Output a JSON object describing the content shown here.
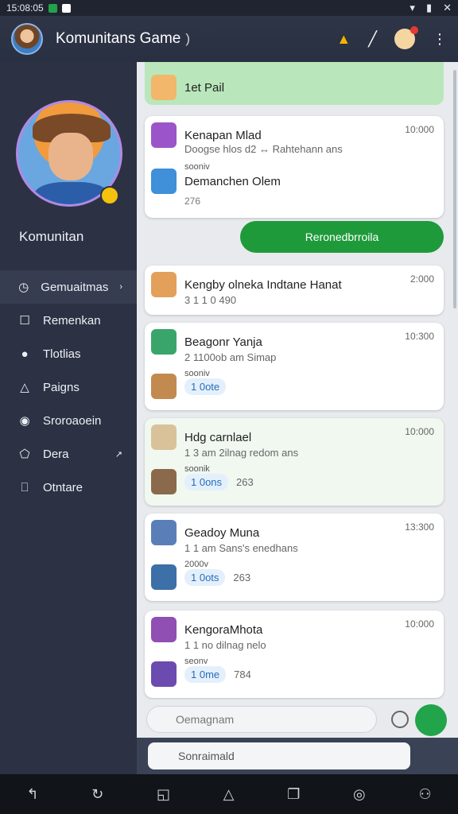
{
  "status": {
    "time": "15:08:05"
  },
  "appbar": {
    "title": "Komunitans Game",
    "divider": ")"
  },
  "sidebar": {
    "community": "Komunitan",
    "items": [
      {
        "label": "Gemuaitmas",
        "active": true
      },
      {
        "label": "Remenkan"
      },
      {
        "label": "Tlotlias"
      },
      {
        "label": "Paigns"
      },
      {
        "label": "Sroroaoein"
      },
      {
        "label": "Dera"
      },
      {
        "label": "Otntare"
      }
    ]
  },
  "chat": {
    "top_banner": "1et Pail",
    "messages": [
      {
        "name": "Kenapan Mlad",
        "time": "10:000",
        "sub1": "Doogse hlos d2 ↔ Rahtehann ans",
        "label1": "sooniv",
        "name2": "Demanchen Olem",
        "meta": "276"
      },
      {
        "pill": "Reronedbrroila"
      },
      {
        "name": "Kengby olneka Indtane Hanat",
        "time": "2:000",
        "sub1": "3 1 1 0 490"
      },
      {
        "name": "Beagonr Yanja",
        "time": "10:300",
        "sub1": "2 1100ob am Simap",
        "label1": "sooniv",
        "pill": "1 0ote"
      },
      {
        "name": "Hdg carnlael",
        "time": "10:000",
        "sub1": "1 3 am 2ilnag redom ans",
        "label1": "soonik",
        "pill": "1 0ons",
        "meta": "263"
      },
      {
        "name": "Geadoy Muna",
        "time": "13:300",
        "sub1": "1 1 am Sans's enedhans",
        "label1": "2000v",
        "pill": "1 0ots",
        "meta": "263"
      },
      {
        "name": "KengoraMhota",
        "time": "10:000",
        "sub1": "1 1 no dilnag nelo",
        "label1": "seonv",
        "pill": "1 0me",
        "meta": "784"
      }
    ]
  },
  "input": {
    "placeholder": "Oemagnam"
  },
  "input2": {
    "placeholder": "Sonraimald"
  },
  "colors": {
    "accent": "#1f9a3b",
    "sidebar": "#2c3243"
  }
}
